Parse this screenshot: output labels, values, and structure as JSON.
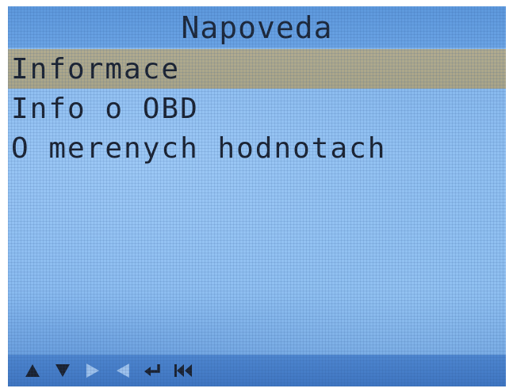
{
  "header": {
    "title": "Napoveda"
  },
  "menu": {
    "items": [
      {
        "label": "Informace",
        "selected": true
      },
      {
        "label": "Info o OBD",
        "selected": false
      },
      {
        "label": "O merenych hodnotach",
        "selected": false
      }
    ]
  },
  "footer": {
    "icons": [
      "up-arrow-icon",
      "down-arrow-icon",
      "right-arrow-icon",
      "left-arrow-icon",
      "enter-icon",
      "back-to-start-icon"
    ]
  },
  "colors": {
    "selection": "#b1ab8f",
    "screen_background": "#86b8ee",
    "text": "#1b2230",
    "icon_active": "#1b2230",
    "icon_disabled": "#9ec2ec"
  }
}
